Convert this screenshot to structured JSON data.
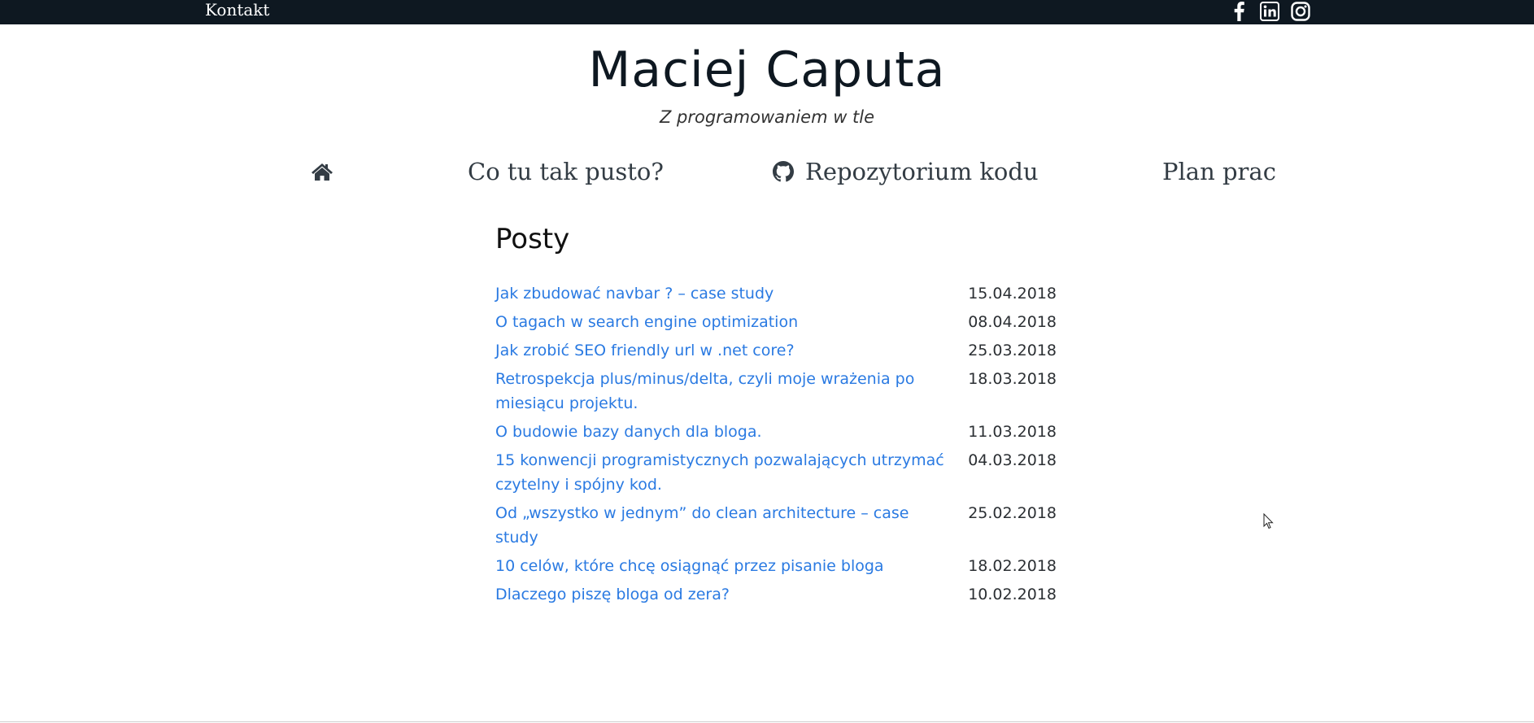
{
  "topbar": {
    "contact_label": "Kontakt",
    "social": [
      {
        "icon": "facebook-icon"
      },
      {
        "icon": "linkedin-icon"
      },
      {
        "icon": "instagram-icon"
      }
    ]
  },
  "header": {
    "title": "Maciej Caputa",
    "subtitle": "Z programowaniem w tle"
  },
  "nav": {
    "home_icon": "home-icon",
    "items": [
      {
        "label": "Co tu tak pusto?"
      },
      {
        "label": "Repozytorium kodu",
        "icon": "github-icon"
      },
      {
        "label": "Plan prac"
      }
    ]
  },
  "posts": {
    "heading": "Posty",
    "items": [
      {
        "title": "Jak zbudować navbar ? – case study",
        "date": "15.04.2018"
      },
      {
        "title": "O tagach w search engine optimization",
        "date": "08.04.2018"
      },
      {
        "title": "Jak zrobić SEO friendly url w .net core?",
        "date": "25.03.2018"
      },
      {
        "title": "Retrospekcja plus/minus/delta, czyli moje wrażenia po miesiącu projektu.",
        "date": "18.03.2018"
      },
      {
        "title": "O budowie bazy danych dla bloga.",
        "date": "11.03.2018"
      },
      {
        "title": "15 konwencji programistycznych pozwalających utrzymać czytelny i spójny kod.",
        "date": "04.03.2018"
      },
      {
        "title": "Od „wszystko w jednym” do clean architecture – case study",
        "date": "25.02.2018"
      },
      {
        "title": "10 celów, które chcę osiągnąć przez pisanie bloga",
        "date": "18.02.2018"
      },
      {
        "title": "Dlaczego piszę bloga od zera?",
        "date": "10.02.2018"
      }
    ]
  },
  "colors": {
    "topbar": "#0e1821",
    "link": "#2a7ae2",
    "title": "#0e1821"
  }
}
